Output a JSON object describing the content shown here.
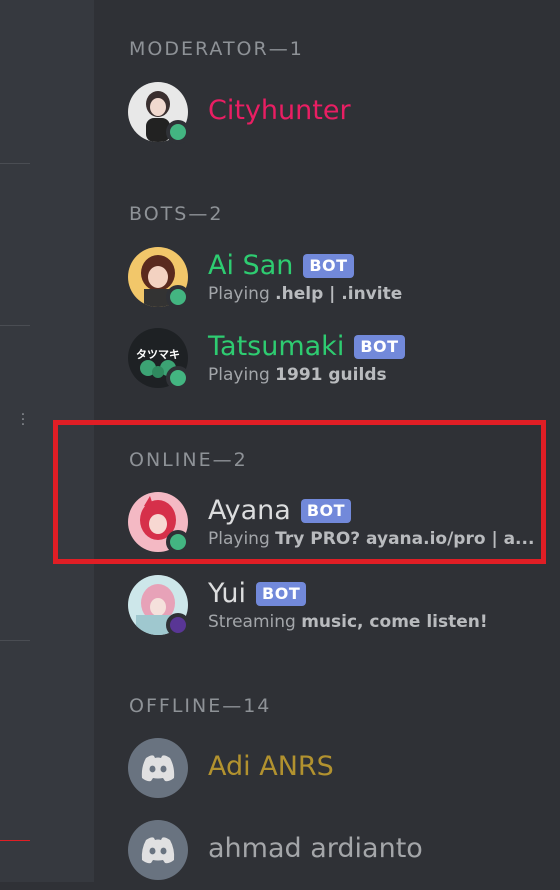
{
  "sections": {
    "moderator": "MODERATOR—1",
    "bots": "BOTS—2",
    "online": "ONLINE—2",
    "offline": "OFFLINE—14"
  },
  "members": {
    "cityhunter": {
      "name": "Cityhunter",
      "color": "#e91e63",
      "status": "online"
    },
    "aisan": {
      "name": "Ai San",
      "tag": "BOT",
      "activity_prefix": "Playing",
      "activity": ".help | .invite",
      "color": "#2ecc71",
      "status": "online"
    },
    "tatsumaki": {
      "name": "Tatsumaki",
      "tag": "BOT",
      "activity_prefix": "Playing",
      "activity": "1991 guilds",
      "color": "#2ecc71",
      "status": "online",
      "avatar_text": "タツマキ"
    },
    "ayana": {
      "name": "Ayana",
      "tag": "BOT",
      "activity_prefix": "Playing",
      "activity": "Try PRO? ayana.io/pro | a...",
      "color": "#dcddde",
      "status": "online"
    },
    "yui": {
      "name": "Yui",
      "tag": "BOT",
      "activity_prefix": "Streaming",
      "activity": "music, come listen!",
      "color": "#dcddde",
      "status": "streaming"
    },
    "adi": {
      "name": "Adi ANRS",
      "color": "#c9a42e",
      "status": "offline"
    },
    "ahmad": {
      "name": "ahmad ardianto",
      "color": "#b9bbbe",
      "status": "offline"
    }
  },
  "colors": {
    "online": "#43b581",
    "streaming": "#593695",
    "highlight": "#e01e25",
    "bot_tag": "#7289da"
  }
}
